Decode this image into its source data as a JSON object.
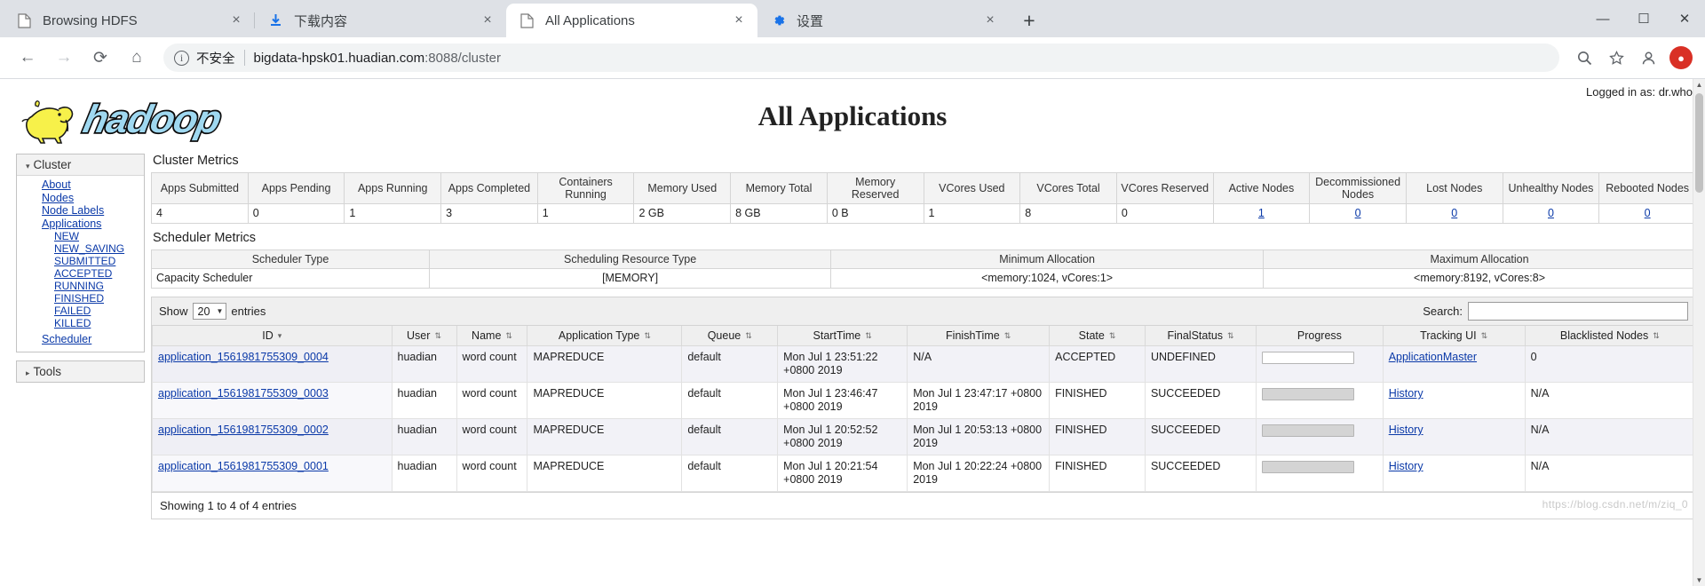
{
  "browser": {
    "tabs": [
      {
        "title": "Browsing HDFS",
        "icon": "page-icon",
        "active": false,
        "close": "×"
      },
      {
        "title": "下载内容",
        "icon": "download-icon",
        "active": false,
        "close": "×"
      },
      {
        "title": "All Applications",
        "icon": "page-icon",
        "active": true,
        "close": "×"
      },
      {
        "title": "设置",
        "icon": "gear-icon",
        "active": false,
        "close": "×"
      }
    ],
    "new_tab_label": "+",
    "window_controls": {
      "minimize": "—",
      "maximize": "☐",
      "close": "✕"
    },
    "nav": {
      "back": "←",
      "forward": "→",
      "reload": "⟳",
      "home": "⌂"
    },
    "omnibox": {
      "info_icon": "i",
      "security_label": "不安全",
      "url_host": "bigdata-hpsk01.huadian.com",
      "url_rest": ":8088/cluster"
    },
    "toolbar_icons": {
      "search": "⌕",
      "bookmark": "☆",
      "profile": "●"
    },
    "avatar_label": "●"
  },
  "page": {
    "logged_in": "Logged in as: dr.who",
    "title": "All Applications",
    "logo_alt": "hadoop"
  },
  "sidebar": {
    "cluster": {
      "header": "Cluster",
      "caret": "▾",
      "items": [
        {
          "label": "About",
          "sub": false
        },
        {
          "label": "Nodes",
          "sub": false
        },
        {
          "label": "Node Labels",
          "sub": false
        },
        {
          "label": "Applications",
          "sub": false
        },
        {
          "label": "NEW",
          "sub": true
        },
        {
          "label": "NEW_SAVING",
          "sub": true
        },
        {
          "label": "SUBMITTED",
          "sub": true
        },
        {
          "label": "ACCEPTED",
          "sub": true
        },
        {
          "label": "RUNNING",
          "sub": true
        },
        {
          "label": "FINISHED",
          "sub": true
        },
        {
          "label": "FAILED",
          "sub": true
        },
        {
          "label": "KILLED",
          "sub": true
        },
        {
          "label": "Scheduler",
          "sub": false
        }
      ]
    },
    "tools": {
      "header": "Tools",
      "caret": "▸"
    }
  },
  "cluster_metrics": {
    "title": "Cluster Metrics",
    "columns": [
      "Apps Submitted",
      "Apps Pending",
      "Apps Running",
      "Apps Completed",
      "Containers Running",
      "Memory Used",
      "Memory Total",
      "Memory Reserved",
      "VCores Used",
      "VCores Total",
      "VCores Reserved",
      "Active Nodes",
      "Decommissioned Nodes",
      "Lost Nodes",
      "Unhealthy Nodes",
      "Rebooted Nodes"
    ],
    "values": [
      "4",
      "0",
      "1",
      "3",
      "1",
      "2 GB",
      "8 GB",
      "0 B",
      "1",
      "8",
      "0",
      "1",
      "0",
      "0",
      "0",
      "0"
    ],
    "link_columns": [
      11,
      12,
      13,
      14,
      15
    ]
  },
  "scheduler_metrics": {
    "title": "Scheduler Metrics",
    "columns": [
      "Scheduler Type",
      "Scheduling Resource Type",
      "Minimum Allocation",
      "Maximum Allocation"
    ],
    "values": [
      "Capacity Scheduler",
      "[MEMORY]",
      "<memory:1024, vCores:1>",
      "<memory:8192, vCores:8>"
    ]
  },
  "apps_table": {
    "show_label": "Show",
    "show_value": "20",
    "entries_label": "entries",
    "search_label": "Search:",
    "search_value": "",
    "search_placeholder": "",
    "columns": [
      {
        "label": "ID",
        "sort": "▾"
      },
      {
        "label": "User",
        "sort": "⇅"
      },
      {
        "label": "Name",
        "sort": "⇅"
      },
      {
        "label": "Application Type",
        "sort": "⇅"
      },
      {
        "label": "Queue",
        "sort": "⇅"
      },
      {
        "label": "StartTime",
        "sort": "⇅"
      },
      {
        "label": "FinishTime",
        "sort": "⇅"
      },
      {
        "label": "State",
        "sort": "⇅"
      },
      {
        "label": "FinalStatus",
        "sort": "⇅"
      },
      {
        "label": "Progress",
        "sort": ""
      },
      {
        "label": "Tracking UI",
        "sort": "⇅"
      },
      {
        "label": "Blacklisted Nodes",
        "sort": "⇅"
      }
    ],
    "rows": [
      {
        "id": "application_1561981755309_0004",
        "user": "huadian",
        "name": "word count",
        "type": "MAPREDUCE",
        "queue": "default",
        "start_time": "Mon Jul 1 23:51:22 +0800 2019",
        "finish_time": "N/A",
        "state": "ACCEPTED",
        "final_status": "UNDEFINED",
        "progress": 0,
        "tracking_ui": "ApplicationMaster",
        "blacklisted": "0"
      },
      {
        "id": "application_1561981755309_0003",
        "user": "huadian",
        "name": "word count",
        "type": "MAPREDUCE",
        "queue": "default",
        "start_time": "Mon Jul 1 23:46:47 +0800 2019",
        "finish_time": "Mon Jul 1 23:47:17 +0800 2019",
        "state": "FINISHED",
        "final_status": "SUCCEEDED",
        "progress": 100,
        "tracking_ui": "History",
        "blacklisted": "N/A"
      },
      {
        "id": "application_1561981755309_0002",
        "user": "huadian",
        "name": "word count",
        "type": "MAPREDUCE",
        "queue": "default",
        "start_time": "Mon Jul 1 20:52:52 +0800 2019",
        "finish_time": "Mon Jul 1 20:53:13 +0800 2019",
        "state": "FINISHED",
        "final_status": "SUCCEEDED",
        "progress": 100,
        "tracking_ui": "History",
        "blacklisted": "N/A"
      },
      {
        "id": "application_1561981755309_0001",
        "user": "huadian",
        "name": "word count",
        "type": "MAPREDUCE",
        "queue": "default",
        "start_time": "Mon Jul 1 20:21:54 +0800 2019",
        "finish_time": "Mon Jul 1 20:22:24 +0800 2019",
        "state": "FINISHED",
        "final_status": "SUCCEEDED",
        "progress": 100,
        "tracking_ui": "History",
        "blacklisted": "N/A"
      }
    ],
    "footer": "Showing 1 to 4 of 4 entries",
    "watermark": "https://blog.csdn.net/m/ziq_0"
  },
  "colors": {
    "link": "#0a39a8",
    "header_bg": "#efefef",
    "row_alt": "#f2f2f7",
    "tab_strip": "#dee1e6",
    "logo_yellow": "#f7f14a",
    "logo_blue": "#9fd8f0"
  }
}
